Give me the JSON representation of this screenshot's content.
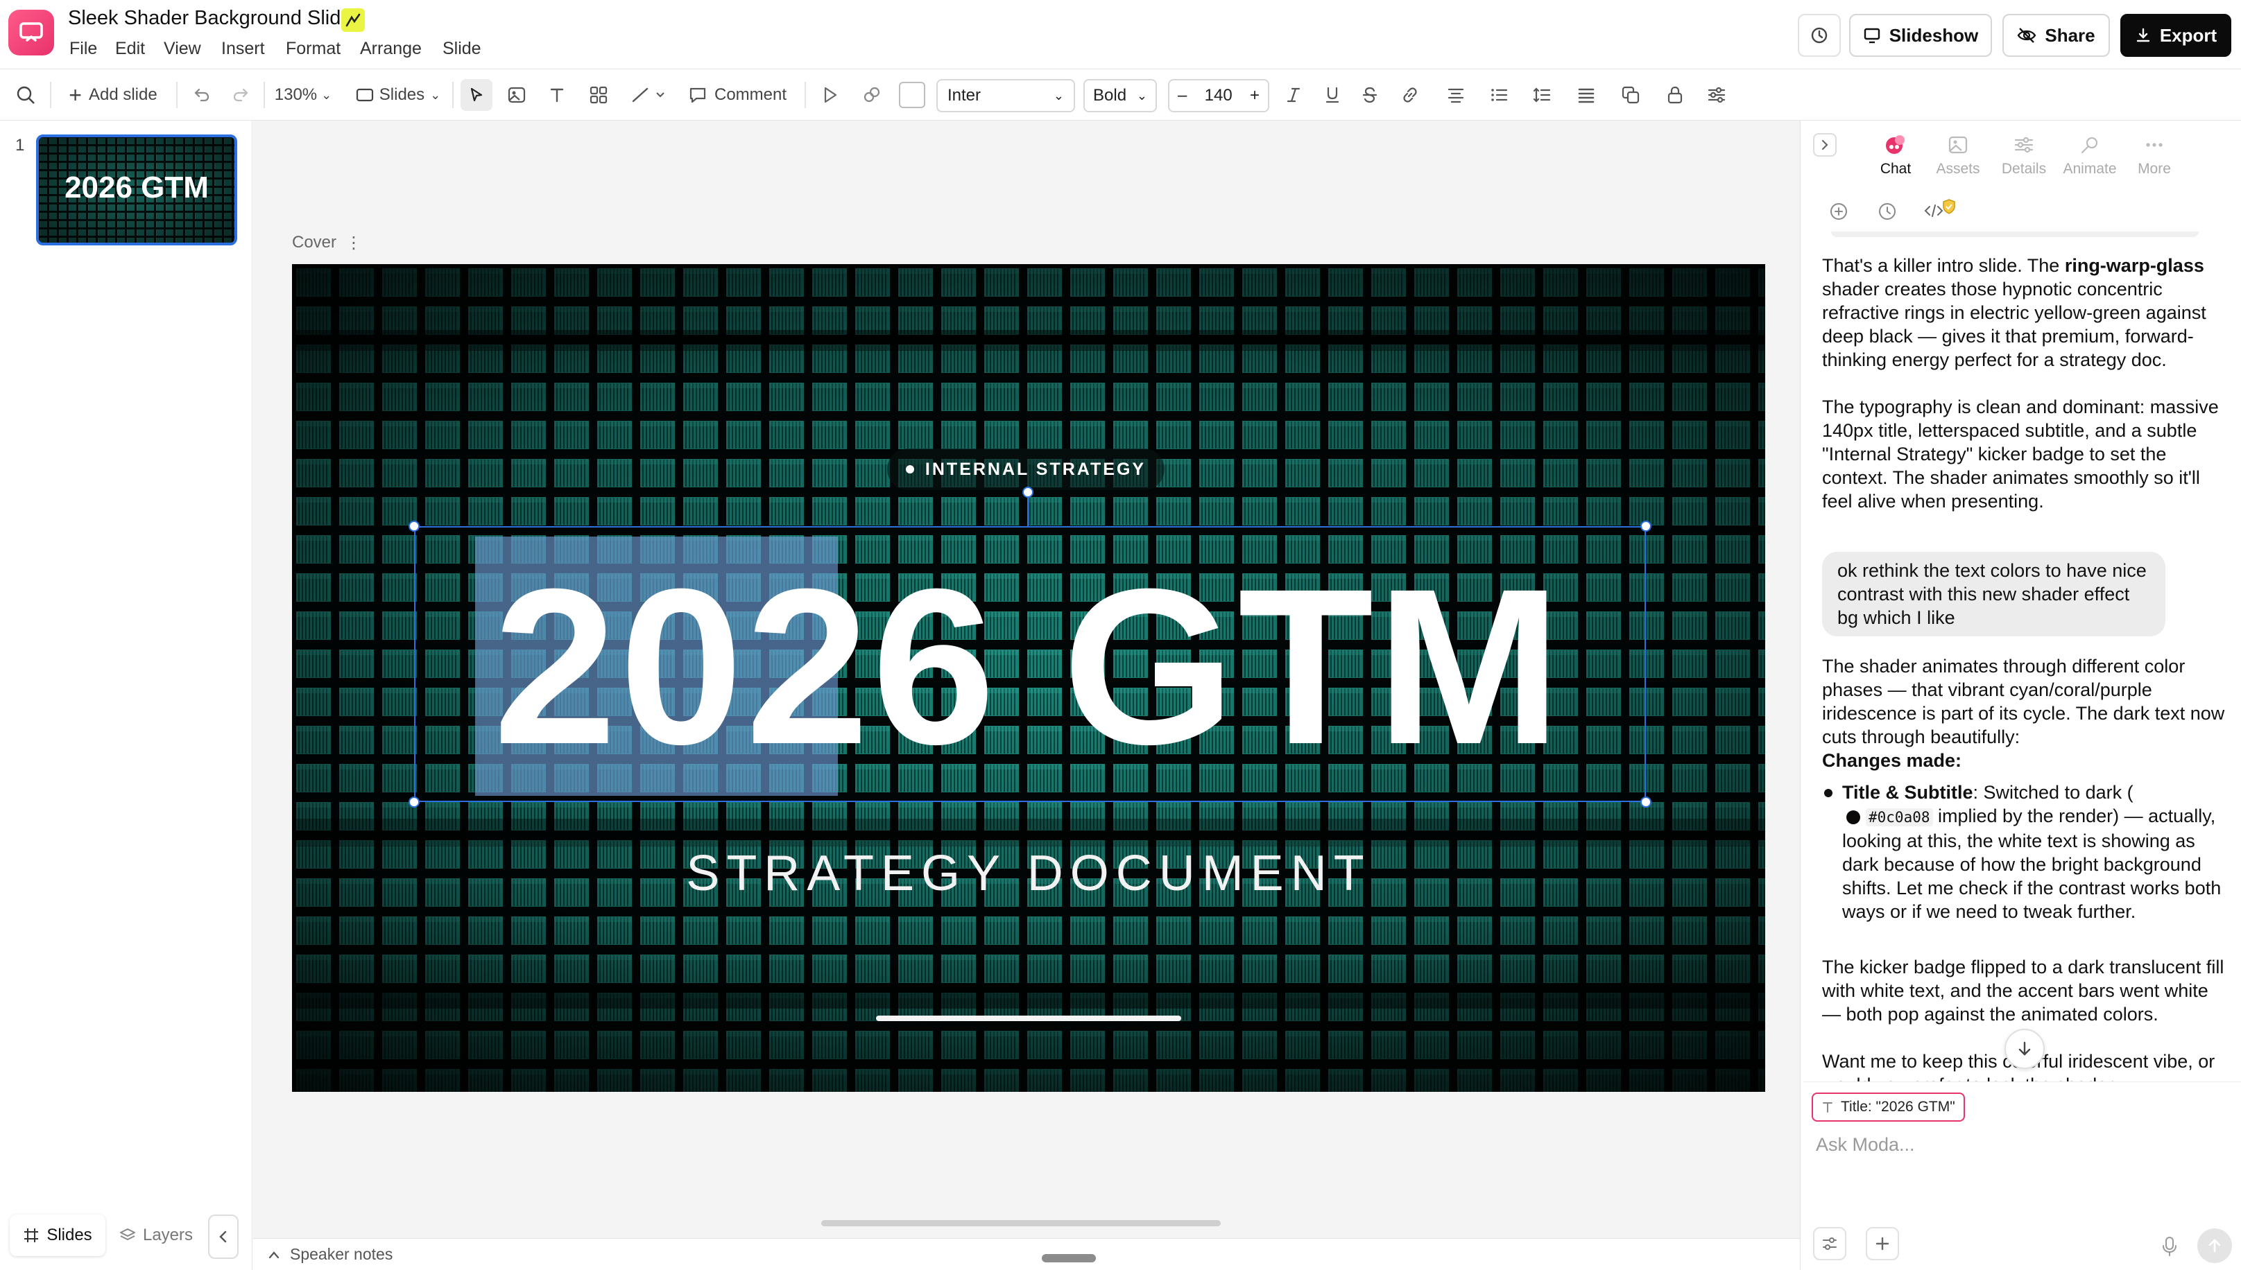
{
  "app": {
    "doc_title": "Sleek Shader Background Slide",
    "menu": [
      "File",
      "Edit",
      "View",
      "Insert",
      "Format",
      "Arrange",
      "Slide"
    ],
    "buttons": {
      "slideshow": "Slideshow",
      "share": "Share",
      "export": "Export"
    },
    "accent_color": "#e8336b"
  },
  "toolbar": {
    "add_slide": "Add slide",
    "zoom": "130%",
    "slides_toggle": "Slides",
    "comment": "Comment",
    "font_family": "Inter",
    "font_weight": "Bold",
    "font_size": "140",
    "minus": "–",
    "plus": "+"
  },
  "left_panel": {
    "slide_number": "1",
    "thumb_title": "2026 GTM",
    "tabs": {
      "slides": "Slides",
      "layers": "Layers"
    }
  },
  "canvas": {
    "slide_label": "Cover",
    "kicker": "INTERNAL STRATEGY",
    "title": "2026 GTM",
    "subtitle": "STRATEGY DOCUMENT",
    "speaker_notes": "Speaker notes"
  },
  "right_panel": {
    "tabs": {
      "chat": "Chat",
      "assets": "Assets",
      "details": "Details",
      "animate": "Animate",
      "more": "More"
    },
    "messages": {
      "a1_p1_pre": "That's a killer intro slide. The ",
      "a1_p1_bold": "ring-warp-glass",
      "a1_p1_post": " shader creates those hypnotic concentric refractive rings in electric yellow-green against deep black — gives it that premium, forward-thinking energy perfect for a strategy doc.",
      "a1_p2": "The typography is clean and dominant: massive 140px title, letterspaced subtitle, and a subtle \"Internal Strategy\" kicker badge to set the context. The shader animates smoothly so it'll feel alive when presenting.",
      "user1": "ok rethink the text colors to have nice contrast with this new shader effect bg which I like",
      "a2_p1": "The shader animates through different color phases — that vibrant cyan/coral/purple iridescence is part of its cycle. The dark text now cuts through beautifully:",
      "a2_changes": "Changes made:",
      "a2_bullet_bold": "Title & Subtitle",
      "a2_bullet_pre": ": Switched to dark (",
      "a2_bullet_code": "#0c0a08",
      "a2_bullet_post": " implied by the render) — actually, looking at this, the white text is showing as dark because of how the bright background shifts. Let me check if the contrast works both ways or if we need to tweak further.",
      "a2_p3": "The kicker badge flipped to a dark translucent fill with white text, and the accent bars went white — both pop against the animated colors.",
      "a2_p4": "Want me to keep this colorful iridescent vibe, or would you prefer to lock the shader"
    },
    "context_chip": "Title: \"2026 GTM\"",
    "input_placeholder": "Ask Moda..."
  }
}
